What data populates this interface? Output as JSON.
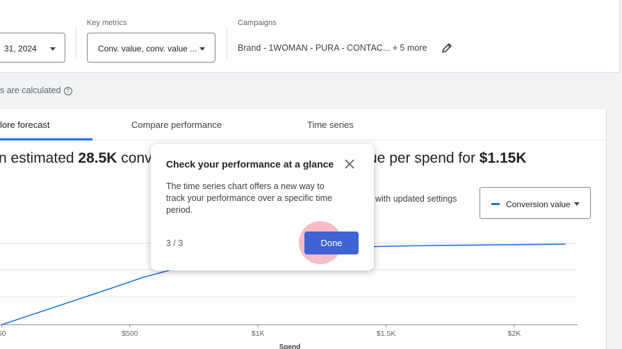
{
  "filters": {
    "date": {
      "value": "31, 2024"
    },
    "key_metrics": {
      "label": "Key metrics",
      "value": "Conv. value, conv. value ..."
    },
    "campaigns": {
      "label": "Campaigns",
      "value": "Brand - 1WOMAN - PURA - CONTAC...",
      "more": "+ 5 more"
    }
  },
  "info_text": "s are calculated",
  "info_icon": "?",
  "tabs": [
    {
      "label": "lore forecast",
      "active": true
    },
    {
      "label": "Compare performance",
      "active": false
    },
    {
      "label": "Time series",
      "active": false
    }
  ],
  "summary": {
    "prefix": "n estimated",
    "conversions": "28.5K",
    "middle": "conve",
    "suffix": "ue per spend for",
    "spend": "$1.15K"
  },
  "updated_settings": "with updated settings",
  "legend_select": {
    "value": "Conversion value"
  },
  "chart_data": {
    "type": "line",
    "xlabel": "Spend",
    "x_tick_labels": [
      "$0",
      "$500",
      "$1K",
      "$1.5K",
      "$2K"
    ],
    "x_ticks": [
      0,
      500,
      1000,
      1500,
      2000
    ],
    "xlim": [
      0,
      2220
    ],
    "series": [
      {
        "values_x": [
          0,
          420,
          550,
          680,
          800,
          1150,
          1600,
          2200
        ],
        "values_y": [
          0,
          0.44,
          0.58,
          0.69,
          0.76,
          0.94,
          0.97,
          0.99
        ],
        "color": "#1a73e8"
      }
    ]
  },
  "popup": {
    "title": "Check your performance at a glance",
    "body": "The time series chart offers a new way to track your performance over a specific time period.",
    "step": "3 / 3",
    "done_label": "Done",
    "close_icon": "close-icon"
  },
  "colors": {
    "accent": "#1a73e8",
    "done_button": "#3f63d3",
    "halo": "#f48fa0"
  }
}
